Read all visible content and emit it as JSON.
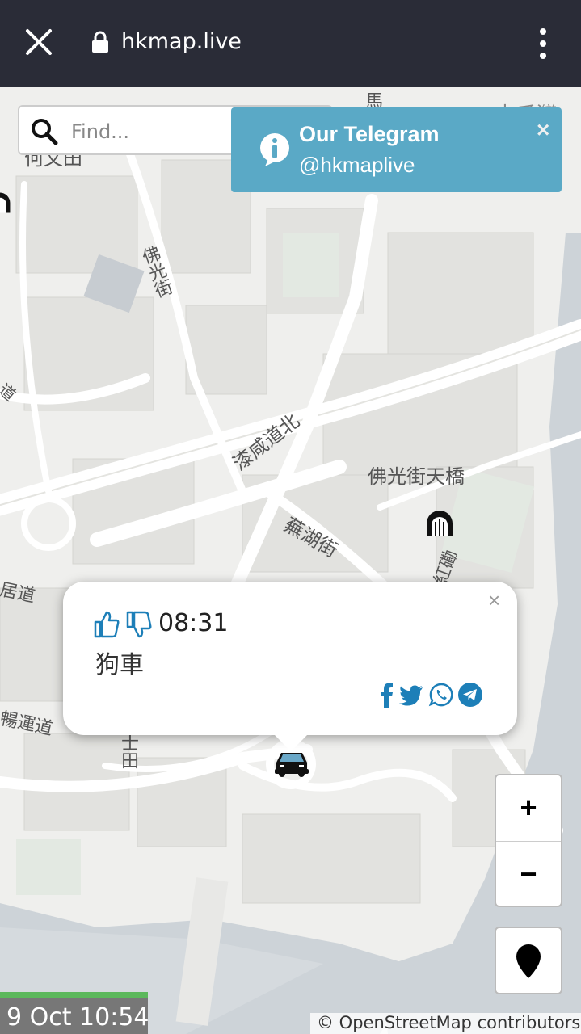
{
  "browser": {
    "url": "hkmap.live"
  },
  "map": {
    "labels": [
      {
        "text": "土瓜灣"
      },
      {
        "text": "何文田"
      },
      {
        "text": "佛光街"
      },
      {
        "text": "漆咸道北"
      },
      {
        "text": "佛光街天橋"
      },
      {
        "text": "蕪湖街"
      },
      {
        "text": "暢運道"
      },
      {
        "text": "居道"
      },
      {
        "text": "馬"
      },
      {
        "text": "道"
      },
      {
        "text": "紅磡"
      },
      {
        "text": "士田"
      }
    ]
  },
  "search": {
    "placeholder": "Find..."
  },
  "toast": {
    "title": "Our Telegram",
    "handle": "@hkmaplive",
    "close": "×"
  },
  "popup": {
    "time": "08:31",
    "description": "狗車",
    "close": "×",
    "share_icons": [
      "facebook-icon",
      "twitter-icon",
      "whatsapp-icon",
      "telegram-icon"
    ]
  },
  "controls": {
    "zoom_in": "+",
    "zoom_out": "−"
  },
  "footer": {
    "timestamp": "9 Oct 10:54",
    "attribution": "© OpenStreetMap contributors"
  },
  "colors": {
    "topbar": "#2a2c37",
    "toast": "#5aa9c6",
    "accent": "#1d7fb8",
    "timebar_green": "#5cb85c"
  }
}
